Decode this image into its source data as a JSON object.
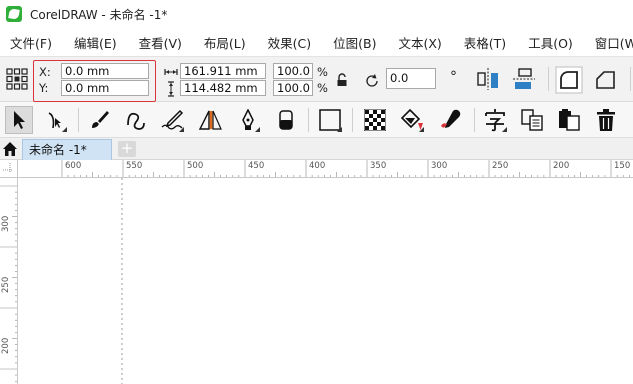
{
  "app": {
    "title": "CorelDRAW - 未命名 -1*"
  },
  "menu": {
    "items": [
      "文件(F)",
      "编辑(E)",
      "查看(V)",
      "布局(L)",
      "效果(C)",
      "位图(B)",
      "文本(X)",
      "表格(T)",
      "工具(O)",
      "窗口(W)"
    ]
  },
  "propbar": {
    "x_label": "X:",
    "y_label": "Y:",
    "x_value": "0.0 mm",
    "y_value": "0.0 mm",
    "width_value": "161.911 mm",
    "height_value": "114.482 mm",
    "scale_x": "100.0",
    "scale_y": "100.0",
    "percent": "%",
    "rotation": "0.0",
    "degree": "°"
  },
  "document": {
    "tab_label": "未命名 -1*",
    "add_tab": "+"
  },
  "ruler": {
    "h_labels": [
      "600",
      "550",
      "500",
      "450",
      "400",
      "350",
      "300",
      "250",
      "200",
      "150"
    ],
    "v_labels": [
      "300",
      "250",
      "200"
    ]
  },
  "colors": {
    "highlight_border": "#d9343a",
    "tab_active": "#cfe3f4",
    "app_icon": "#2fae3a"
  }
}
